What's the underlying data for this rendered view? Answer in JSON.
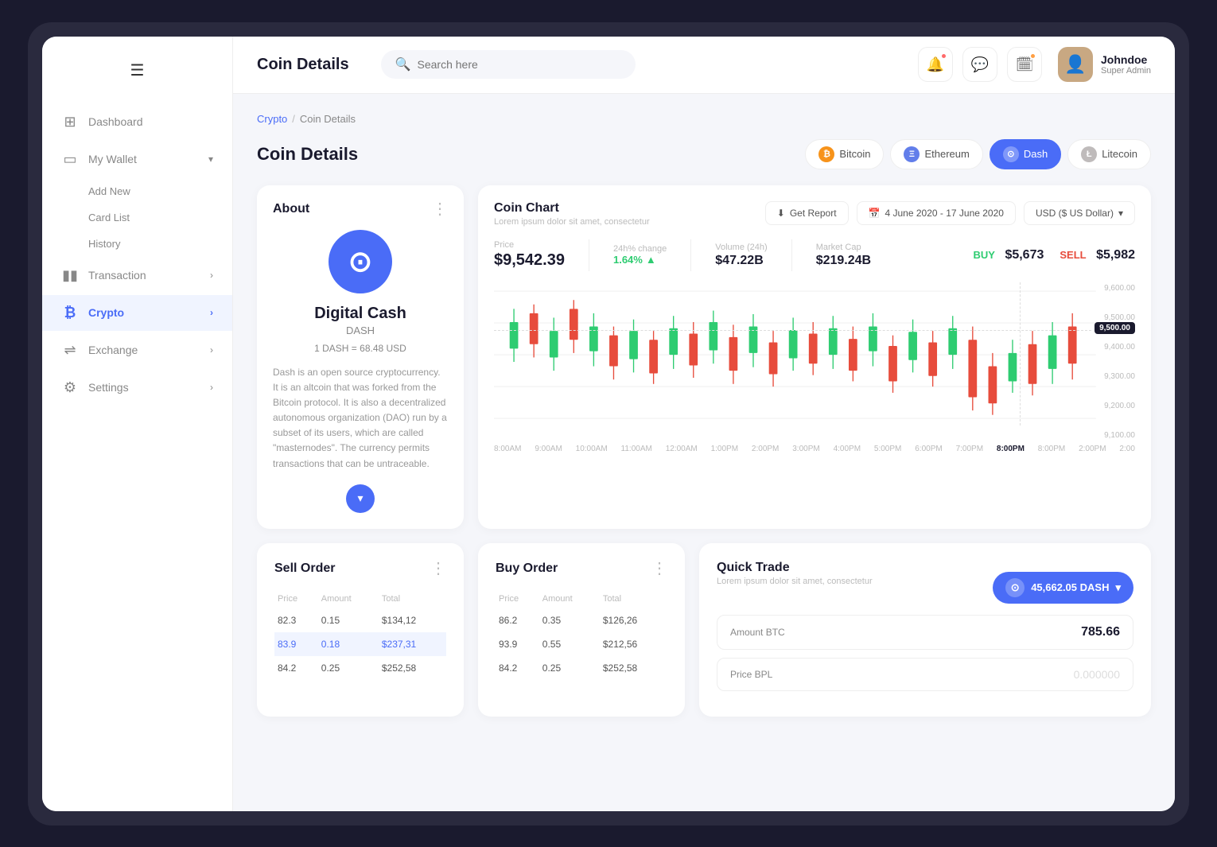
{
  "header": {
    "title": "Coin Details",
    "search_placeholder": "Search here"
  },
  "user": {
    "name": "Johndoe",
    "role": "Super Admin"
  },
  "sidebar": {
    "items": [
      {
        "label": "Dashboard",
        "icon": "grid",
        "active": false
      },
      {
        "label": "My Wallet",
        "icon": "wallet",
        "active": false,
        "has_arrow": true
      },
      {
        "label": "Add New",
        "active": false
      },
      {
        "label": "Card List",
        "active": false
      },
      {
        "label": "History",
        "active": false
      },
      {
        "label": "Transaction",
        "icon": "bar-chart",
        "active": false,
        "has_arrow": true
      },
      {
        "label": "Crypto",
        "icon": "bitcoin",
        "active": true,
        "has_arrow": true
      },
      {
        "label": "Exchange",
        "icon": "exchange",
        "active": false,
        "has_arrow": true
      },
      {
        "label": "Settings",
        "icon": "settings",
        "active": false,
        "has_arrow": true
      }
    ]
  },
  "breadcrumb": {
    "parent": "Crypto",
    "separator": "/",
    "current": "Coin Details"
  },
  "page_title": "Coin Details",
  "coin_tabs": [
    {
      "label": "Bitcoin",
      "color": "#f7931a",
      "symbol": "₿",
      "active": false
    },
    {
      "label": "Ethereum",
      "color": "#627eea",
      "symbol": "Ξ",
      "active": false
    },
    {
      "label": "Dash",
      "color": "#fff",
      "bg": "#4a6cf7",
      "symbol": "⊙",
      "active": true
    },
    {
      "label": "Litecoin",
      "color": "#bfbbbb",
      "symbol": "Ł",
      "active": false
    }
  ],
  "about": {
    "title": "About",
    "coin_name": "Digital Cash",
    "coin_symbol": "DASH",
    "coin_rate": "1 DASH = 68.48 USD",
    "description": "Dash is an open source cryptocurrency. It is an altcoin that was forked from the Bitcoin protocol. It is also a decentralized autonomous organization (DAO) run by a subset of its users, which are called \"masternodes\". The currency permits transactions that can be untraceable."
  },
  "coin_chart": {
    "title": "Coin Chart",
    "subtitle": "Lorem ipsum dolor sit amet, consectetur",
    "get_report_label": "Get Report",
    "date_range": "4 June 2020 - 17 June 2020",
    "currency": "USD ($ US Dollar)",
    "price_label": "Price",
    "price_value": "$9,542.39",
    "change_label": "24h% change",
    "change_value": "1.64%",
    "volume_label": "Volume (24h)",
    "volume_value": "$47.22B",
    "market_cap_label": "Market Cap",
    "market_cap_value": "$219.24B",
    "buy_label": "BUY",
    "buy_value": "$5,673",
    "sell_label": "SELL",
    "sell_value": "$5,982",
    "y_labels": [
      "9,600.00",
      "9,500.00",
      "9,400.00",
      "9,300.00",
      "9,200.00",
      "9,100.00"
    ],
    "x_labels": [
      "8:00AM",
      "9:00AM",
      "10:00AM",
      "11:00AM",
      "12:00AM",
      "1:00PM",
      "2:00PM",
      "3:00PM",
      "4:00PM",
      "5:00PM",
      "6:00PM",
      "7:00PM",
      "8:00PM",
      "8:00PM",
      "2:00PM",
      "2:00"
    ],
    "current_price_label": "9,500.00"
  },
  "sell_order": {
    "title": "Sell Order",
    "columns": [
      "Price",
      "Amount",
      "Total"
    ],
    "rows": [
      {
        "price": "82.3",
        "amount": "0.15",
        "total": "$134,12",
        "highlight": false
      },
      {
        "price": "83.9",
        "amount": "0.18",
        "total": "$237,31",
        "highlight": true
      },
      {
        "price": "84.2",
        "amount": "0.25",
        "total": "$252,58",
        "highlight": false
      }
    ]
  },
  "buy_order": {
    "title": "Buy Order",
    "columns": [
      "Price",
      "Amount",
      "Total"
    ],
    "rows": [
      {
        "price": "86.2",
        "amount": "0.35",
        "total": "$126,26",
        "highlight": false
      },
      {
        "price": "93.9",
        "amount": "0.55",
        "total": "$212,56",
        "highlight": false
      },
      {
        "price": "84.2",
        "amount": "0.25",
        "total": "$252,58",
        "highlight": false
      }
    ]
  },
  "quick_trade": {
    "title": "Quick Trade",
    "subtitle": "Lorem ipsum dolor sit amet, consectetur",
    "coin_selector_label": "45,662.05 DASH",
    "amount_label": "Amount BTC",
    "amount_value": "785.66",
    "price_label": "Price BPL",
    "price_placeholder": "0.000000"
  }
}
